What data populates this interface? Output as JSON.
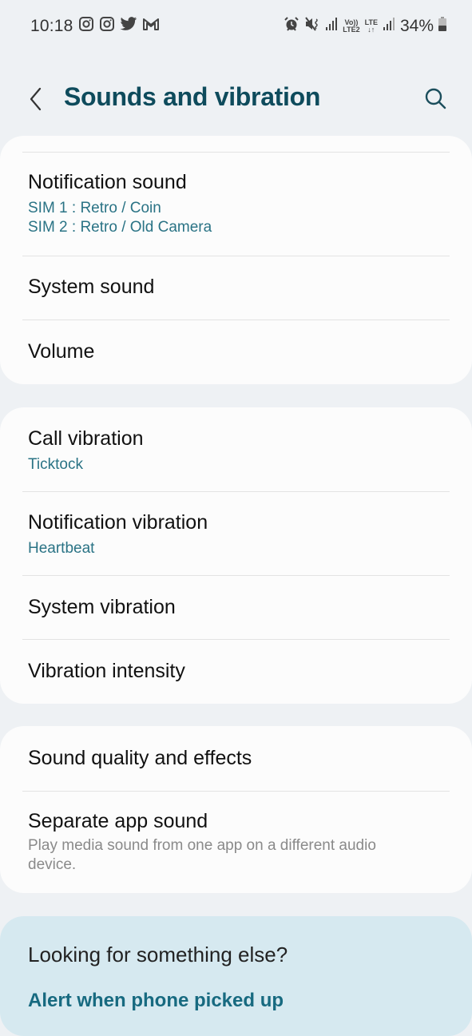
{
  "status_bar": {
    "time": "10:18",
    "left_icons": [
      "instagram-icon",
      "instagram-icon",
      "twitter-icon",
      "gmail-icon"
    ],
    "right_icons": [
      "alarm-icon",
      "mute-vibrate-icon",
      "signal-icon",
      "volte-lte2-icon",
      "lte-data-icon",
      "signal-icon",
      "battery-icon"
    ],
    "volte_label_top": "Vo))",
    "volte_label_bottom": "LTE2",
    "lte_label_top": "LTE",
    "lte_label_bottom": "↓↑",
    "battery": "34%"
  },
  "header": {
    "title": "Sounds and vibration",
    "back_icon": "back-chevron-icon",
    "search_icon": "search-icon"
  },
  "groups": [
    {
      "items": [
        {
          "label": "Notification sound",
          "sub1": "SIM 1 : Retro / Coin",
          "sub2": "SIM 2 : Retro / Old Camera"
        },
        {
          "label": "System sound"
        },
        {
          "label": "Volume"
        }
      ]
    },
    {
      "items": [
        {
          "label": "Call vibration",
          "sub1": "Ticktock"
        },
        {
          "label": "Notification vibration",
          "sub1": "Heartbeat"
        },
        {
          "label": "System vibration"
        },
        {
          "label": "Vibration intensity"
        }
      ]
    },
    {
      "items": [
        {
          "label": "Sound quality and effects"
        },
        {
          "label": "Separate app sound",
          "sub1": "Play media sound from one app on a different audio",
          "sub2": "device."
        }
      ]
    }
  ],
  "suggestions": {
    "question": "Looking for something else?",
    "link": "Alert when phone picked up"
  },
  "colors": {
    "background": "#eef1f4",
    "card": "#fcfcfc",
    "title": "#0e4b5c",
    "accent_sub": "#2a7385",
    "suggest_bg": "#d6e9f0",
    "suggest_link": "#176a80"
  }
}
